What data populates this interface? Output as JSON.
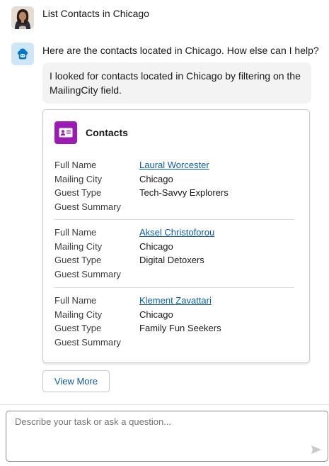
{
  "user_message": {
    "text": "List Contacts in Chicago"
  },
  "assistant": {
    "reply": "Here are the contacts located in Chicago. How else can I help?",
    "explanation": "I looked for contacts located in Chicago by filtering on the MailingCity field."
  },
  "card": {
    "title": "Contacts",
    "icon": "contact-card-icon",
    "labels": {
      "full_name": "Full Name",
      "mailing_city": "Mailing City",
      "guest_type": "Guest Type",
      "guest_summary": "Guest Summary"
    },
    "records": [
      {
        "full_name": "Laural Worcester",
        "mailing_city": "Chicago",
        "guest_type": "Tech-Savvy Explorers",
        "guest_summary": ""
      },
      {
        "full_name": "Aksel Christoforou",
        "mailing_city": "Chicago",
        "guest_type": "Digital Detoxers",
        "guest_summary": ""
      },
      {
        "full_name": "Klement Zavattari",
        "mailing_city": "Chicago",
        "guest_type": "Family Fun Seekers",
        "guest_summary": ""
      }
    ]
  },
  "view_more_label": "View More",
  "composer": {
    "placeholder": "Describe your task or ask a question..."
  },
  "colors": {
    "card_icon_bg": "#9b1bb3",
    "link": "#0b5cab",
    "bot_avatar_bg": "#cfe6f7",
    "bubble_bg": "#f3f3f3"
  }
}
